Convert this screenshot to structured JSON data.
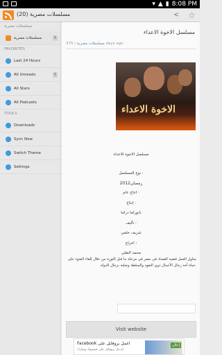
{
  "status_bar": {
    "time": "8:08 PM"
  },
  "app_bar": {
    "title": "مسلسلات مصرية (20)"
  },
  "sidebar": {
    "section_feed": "مسلسلات مصرية",
    "feed_item": {
      "label": "مسلسلات مصرية",
      "count": "5"
    },
    "section_favorites": "FAVORITES",
    "favorites": [
      {
        "label": "Last 24 Hours",
        "icon": "clock-icon",
        "color": "#3d9be0"
      },
      {
        "label": "All Unreads",
        "count": "5",
        "icon": "unread-icon",
        "color": "#3d9be0"
      },
      {
        "label": "All Stars",
        "icon": "star-icon",
        "color": "#3d9be0"
      },
      {
        "label": "All Podcasts",
        "icon": "podcast-icon",
        "color": "#3d9be0"
      }
    ],
    "section_tools": "TOOLS",
    "tools": [
      {
        "label": "Downloads",
        "icon": "download-icon"
      },
      {
        "label": "Sync Now",
        "icon": "sync-icon"
      },
      {
        "label": "Switch Theme",
        "icon": "theme-icon"
      },
      {
        "label": "Settings",
        "icon": "settings-icon"
      }
    ]
  },
  "article": {
    "title": "مسلسل الاخوة الاعداء",
    "meta_count": "375",
    "meta_feed": "مسلسلات مصرية",
    "meta_time": "days ago",
    "poster_title": "الاخوة الاعداء",
    "lines": [
      "مسلسل الاخوة الاعداء",
      "نوع المسلسل :",
      "رمضان2012",
      "انتاج عام :",
      "إنتاج :",
      "بانوراما دراما",
      "تأليف :",
      "شريف حلمي",
      "اخراج :",
      "محمد النقلي"
    ],
    "paragraph": "يتناول العمل قضية الفساد في مصر في مرحلة ما قبل الثورة من خلال إلقاء الضوء على حياة أحد رجال الأعمال ذوي النفوذ والسلطة وصلته برجال الدولة.",
    "visit_label": "Visit website"
  },
  "ad": {
    "line1": "Facebook اعمل بروفايل على",
    "line2": "اع مل بروفايل على فيسبوك وشارك",
    "button": "إعلان"
  }
}
